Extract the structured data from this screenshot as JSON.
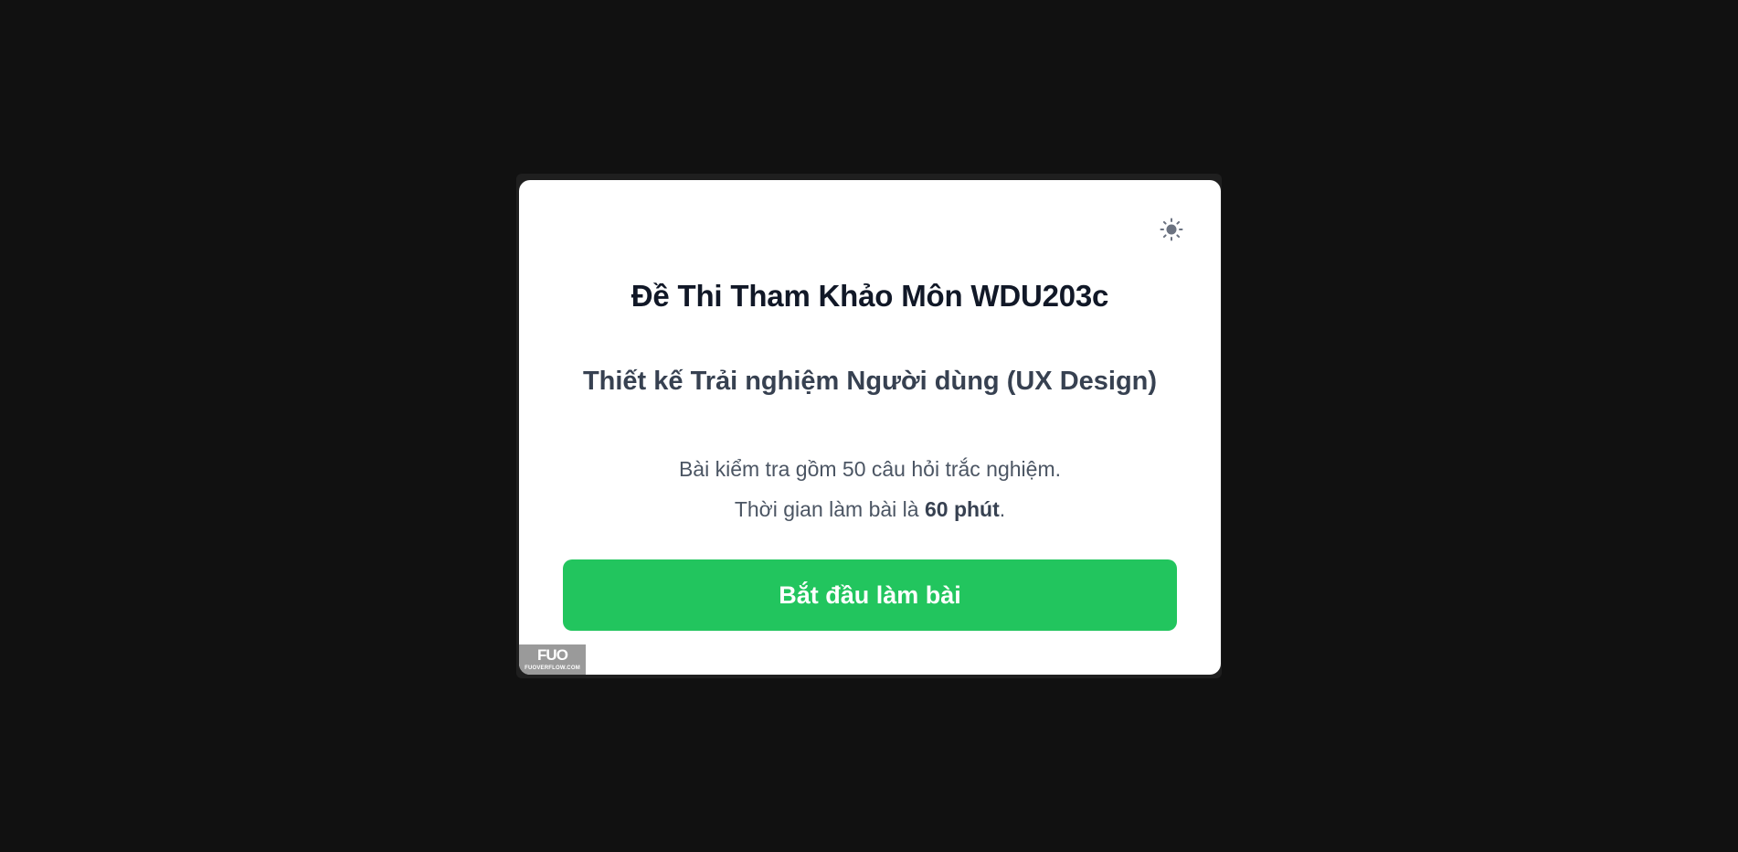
{
  "modal": {
    "title": "Đề Thi Tham Khảo Môn WDU203c",
    "subtitle": "Thiết kế Trải nghiệm Người dùng (UX Design)",
    "description_line1": "Bài kiểm tra gồm 50 câu hỏi trắc nghiệm.",
    "description_line2_prefix": "Thời gian làm bài là ",
    "description_line2_time": "60 phút",
    "description_line2_suffix": ".",
    "start_button_label": "Bắt đầu làm bài",
    "theme_toggle_icon": "sun-icon"
  },
  "watermark": {
    "logo": "FUO",
    "site": "FUOVERFLOW.COM"
  },
  "colors": {
    "backdrop": "#111111",
    "modal_bg": "#ffffff",
    "primary_button": "#22c55e",
    "title_text": "#111827",
    "subtitle_text": "#374151",
    "body_text": "#4b5563",
    "icon": "#6b7280"
  }
}
